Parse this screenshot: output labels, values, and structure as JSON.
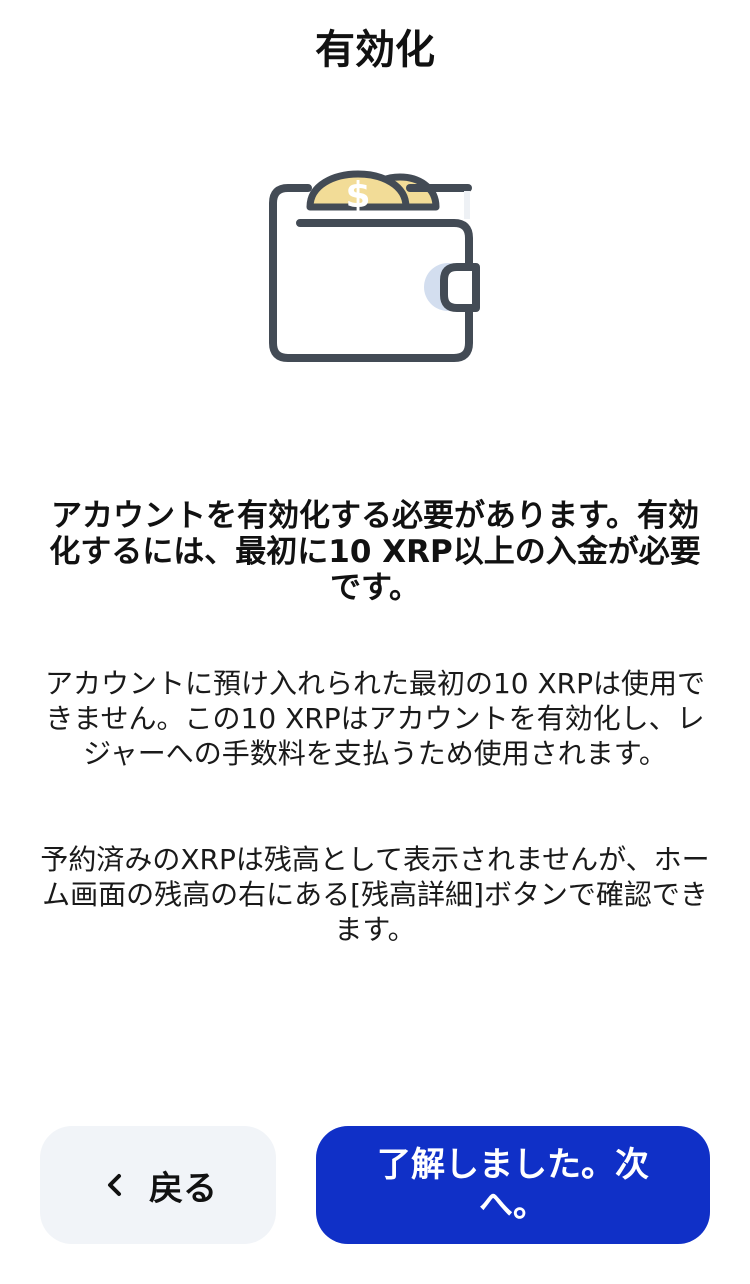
{
  "header": {
    "title": "有効化"
  },
  "illustration": {
    "icon": "wallet-with-coins-icon",
    "colors": {
      "outline": "#434b55",
      "coin": "#f2dc97",
      "clasp_accent": "#d3deef"
    }
  },
  "content": {
    "headline": "アカウントを有効化する必要があります。有効化するには、最初に10 XRP以上の入金が必要です。",
    "paragraph1": "アカウントに預け入れられた最初の10 XRPは使用できません。この10 XRPはアカウントを有効化し、レジャーへの手数料を支払うため使用されます。",
    "paragraph2": "予約済みのXRPは残高として表示されませんが、ホーム画面の残高の右にある[残高詳細]ボタンで確認できます。"
  },
  "actions": {
    "back_label": "戻る",
    "back_icon": "chevron-left-icon",
    "next_label": "了解しました。次へ。"
  },
  "colors": {
    "primary": "#1030c7",
    "secondary_bg": "#f1f4f8"
  }
}
